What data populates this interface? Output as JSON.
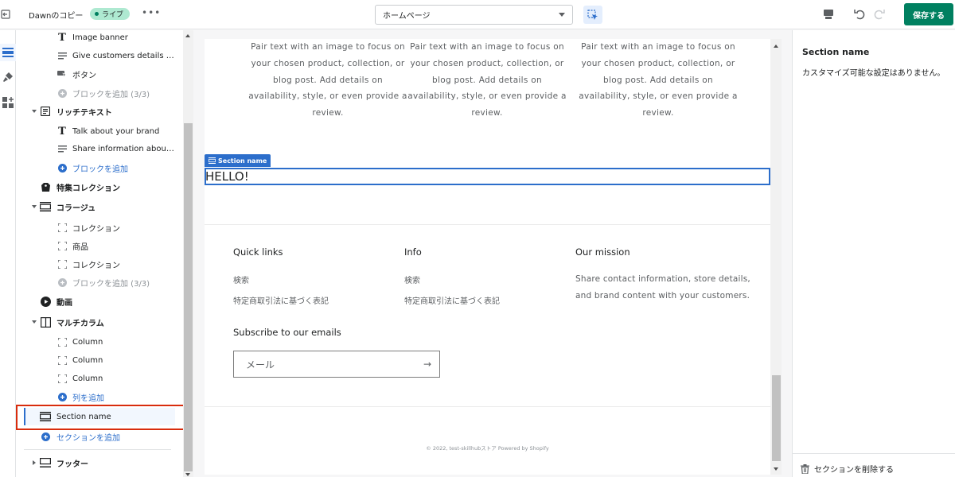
{
  "topbar": {
    "theme_name": "Dawnのコピー",
    "live_badge": "ライブ",
    "more": "•••",
    "page_select": "ホームページ",
    "save_label": "保存する"
  },
  "sidebar": {
    "items": [
      {
        "label": "Image banner"
      },
      {
        "label": "Give customers details about the banner image(s) or content on the template."
      },
      {
        "label": "ボタン"
      },
      {
        "label": "ブロックを追加 (3/3)"
      },
      {
        "label": "リッチテキスト"
      },
      {
        "label": "Talk about your brand"
      },
      {
        "label": "Share information about your brand with your customers."
      },
      {
        "label": "ブロックを追加"
      },
      {
        "label": "特集コレクション"
      },
      {
        "label": "コラージュ"
      },
      {
        "label": "コレクション"
      },
      {
        "label": "商品"
      },
      {
        "label": "コレクション"
      },
      {
        "label": "ブロックを追加 (3/3)"
      },
      {
        "label": "動画"
      },
      {
        "label": "マルチカラム"
      },
      {
        "label": "Column"
      },
      {
        "label": "Column"
      },
      {
        "label": "Column"
      },
      {
        "label": "列を追加"
      },
      {
        "label": "Section name"
      },
      {
        "label": "セクションを追加"
      },
      {
        "label": "フッター"
      }
    ]
  },
  "preview": {
    "column_text": "Pair text with an image to focus on your chosen product, collection, or blog post. Add details on availability, style, or even provide a review.",
    "section_tag": "Section name",
    "hello": "HELLO!",
    "footer": {
      "quick_links_heading": "Quick links",
      "quick_links": [
        "検索",
        "特定商取引法に基づく表記"
      ],
      "info_heading": "Info",
      "info_links": [
        "検索",
        "特定商取引法に基づく表記"
      ],
      "mission_heading": "Our mission",
      "mission_text": "Share contact information, store details, and brand content with your customers.",
      "subscribe_heading": "Subscribe to our emails",
      "email_placeholder": "メール",
      "arrow": "→",
      "copyright": "© 2022, test-skillhubストア Powered by Shopify"
    }
  },
  "right_panel": {
    "title": "Section name",
    "message": "カスタマイズ可能な設定はありません。",
    "delete_label": "セクションを削除する"
  },
  "colors": {
    "accent": "#2c6ecb",
    "save": "#008060",
    "live_badge": "#aee9d1",
    "highlight_frame": "#d82c0d"
  }
}
